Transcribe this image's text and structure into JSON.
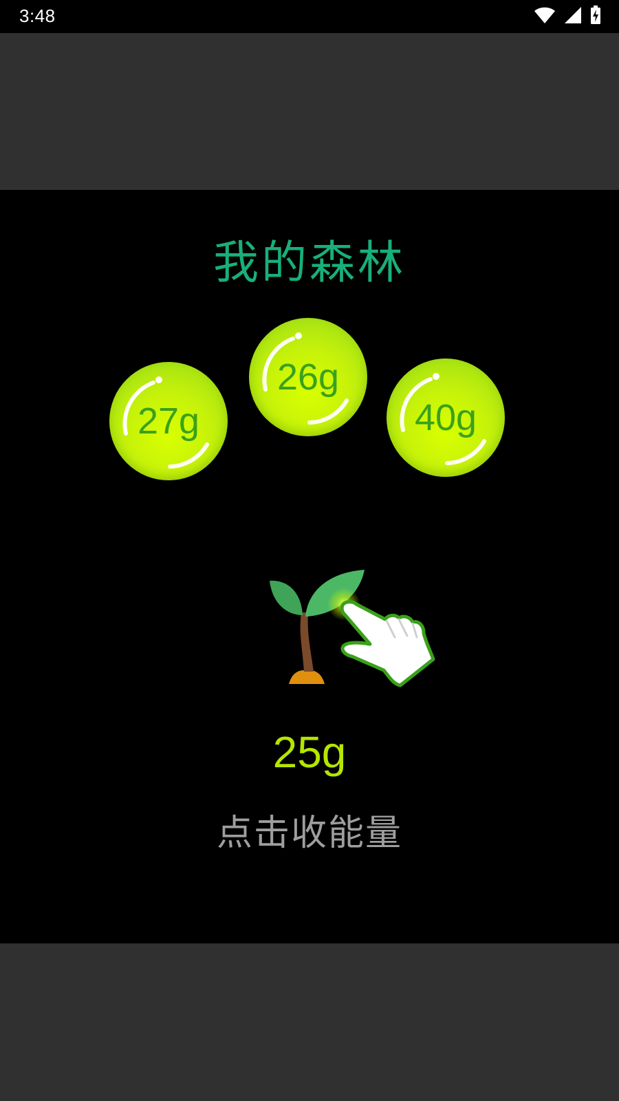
{
  "status_bar": {
    "time": "3:48",
    "icons": [
      "wifi-icon",
      "cell-signal-icon",
      "battery-charging-icon"
    ]
  },
  "forest": {
    "title": "我的森林",
    "bubbles": [
      {
        "label": "27g"
      },
      {
        "label": "26g"
      },
      {
        "label": "40g"
      }
    ],
    "energy_value": "25g",
    "hint": "点击收能量",
    "icons": [
      "sapling-icon",
      "tap-hand-icon"
    ]
  },
  "colors": {
    "title": "#18b07a",
    "bubble": "#c6f20a",
    "bubble_text": "#3aa11a",
    "energy_text": "#b5e600",
    "hint_text": "#9e9e9e",
    "panel_bg": "#000000",
    "outer_bg": "#303030"
  }
}
